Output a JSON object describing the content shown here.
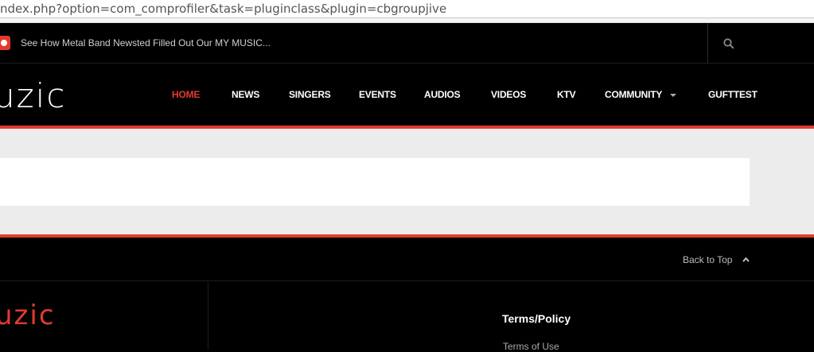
{
  "browser": {
    "url": "ndex.php?option=com_comprofiler&task=pluginclass&plugin=cbgroupjive"
  },
  "topbar": {
    "ticker_text": "See How Metal Band Newsted Filled Out Our MY MUSIC...",
    "search_icon": "search-icon"
  },
  "brand": {
    "logo_text": "uzic",
    "accent_color": "#e23b2e"
  },
  "nav": {
    "items": [
      {
        "label": "HOME",
        "active": true
      },
      {
        "label": "NEWS"
      },
      {
        "label": "SINGERS"
      },
      {
        "label": "EVENTS"
      },
      {
        "label": "AUDIOS"
      },
      {
        "label": "VIDEOS"
      },
      {
        "label": "KTV"
      },
      {
        "label": "COMMUNITY",
        "has_dropdown": true
      },
      {
        "label": "GUFTTEST"
      }
    ]
  },
  "footer": {
    "back_to_top": "Back to Top",
    "logo_text": "uzic",
    "section_heading": "Terms/Policy",
    "links": [
      "Terms of Use"
    ]
  }
}
